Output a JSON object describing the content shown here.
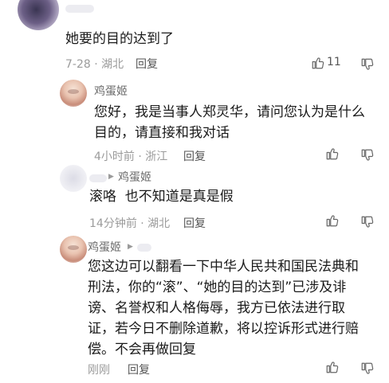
{
  "comments": [
    {
      "text": "她要的目的达到了",
      "meta": "7-28 · 湖北",
      "reply": "回复",
      "likes": "11"
    },
    {
      "author": "鸡蛋姬",
      "lines": [
        "您好，我是当事人郑灵华，请问您认为是什么",
        "目的，请直接和我对话"
      ],
      "meta": "4小时前 · 浙江",
      "reply": "回复"
    },
    {
      "author": "鸡蛋姬",
      "text": "滚咯  也不知道是真是假",
      "meta": "14分钟前 · 湖北",
      "reply": "回复"
    },
    {
      "author": "鸡蛋姬",
      "lines": [
        "您这边可以翻看一下中华人民共和国民法典和",
        "刑法，你的“滚”、“她的目的达到”已涉及诽",
        "谤、名誉权和人格侮辱，我方已依法进行取",
        "证，若今日不删除道歉，将以控诉形式进行赔",
        "偿。不会再做回复"
      ],
      "meta": "刚刚",
      "reply": "回复"
    }
  ],
  "icons": {
    "like": "thumbs-up-icon",
    "dislike": "thumbs-down-icon"
  }
}
